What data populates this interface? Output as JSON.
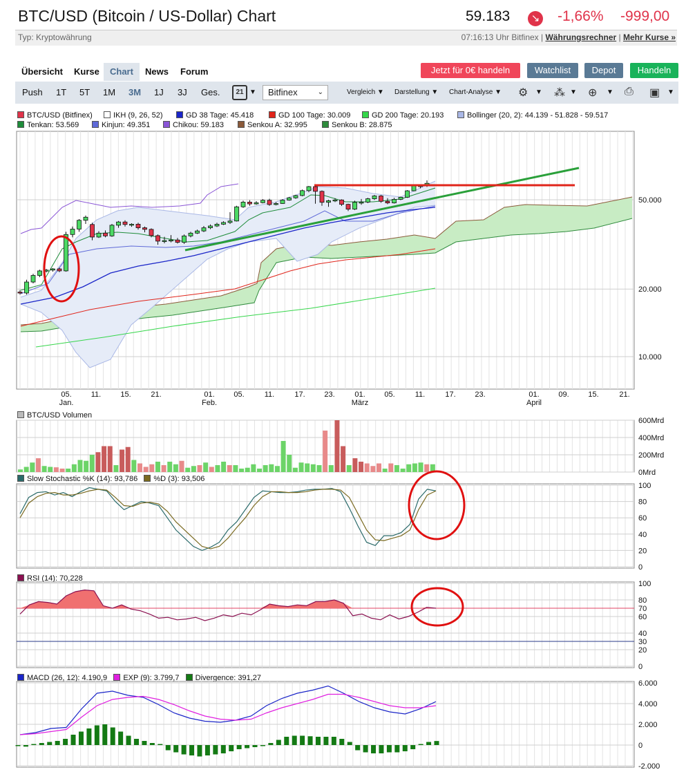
{
  "header": {
    "title": "BTC/USD (Bitcoin / US-Dollar) Chart",
    "price": "59.183",
    "arrow_icon": "arrow-down-right-icon",
    "change_pct": "-1,66%",
    "change_abs": "-999,00"
  },
  "subbar": {
    "type": "Typ: Kryptowährung",
    "time": "07:16:13 Uhr Bitfinex",
    "currency_link": "Währungsrechner",
    "more_link": "Mehr Kurse »"
  },
  "tabs": [
    "Übersicht",
    "Kurse",
    "Chart",
    "News",
    "Forum"
  ],
  "actions": {
    "trade_free": "Jetzt für 0€ handeln",
    "watchlist": "Watchlist",
    "depot": "Depot",
    "handeln": "Handeln"
  },
  "toolbar": {
    "ranges": [
      "Push",
      "1T",
      "5T",
      "1M",
      "3M",
      "1J",
      "3J",
      "Ges."
    ],
    "active_range": "3M",
    "calendar_day": "21",
    "exchange": "Bitfinex",
    "compare": "Vergleich",
    "display": "Darstellung",
    "analysis": "Chart-Analyse"
  },
  "colors": {
    "up": "#4cd964",
    "down": "#e0334a",
    "accent_red": "#f0465a",
    "btn_gray": "#5a7a95",
    "btn_green": "#19b35a"
  },
  "main_legend": [
    {
      "label": "BTC/USD (Bitfinex)",
      "color": "#e0334a"
    },
    {
      "label": "IKH (9, 26, 52)",
      "color": "#ffffff"
    },
    {
      "label": "GD 38 Tage: 45.418",
      "color": "#1a25c8"
    },
    {
      "label": "GD 100 Tage: 30.009",
      "color": "#e0241a"
    },
    {
      "label": "GD 200 Tage: 20.193",
      "color": "#35d64a"
    },
    {
      "label": "Bollinger (20, 2): 44.139 - 51.828 - 59.517",
      "color": "#aab8e6"
    },
    {
      "label": "Tenkan: 53.569",
      "color": "#1e8c3a"
    },
    {
      "label": "Kinjun: 49.351",
      "color": "#5f6ad8"
    },
    {
      "label": "Chikou: 59.183",
      "color": "#8a55d6"
    },
    {
      "label": "Senkou A: 32.995",
      "color": "#8b5a3a"
    },
    {
      "label": "Senkou B: 28.875",
      "color": "#2e8b3c"
    }
  ],
  "price_axis": [
    "50.000",
    "20.000",
    "10.000"
  ],
  "date_axis": [
    {
      "d": "05.",
      "m": "Jan."
    },
    {
      "d": "11.",
      "m": ""
    },
    {
      "d": "15.",
      "m": ""
    },
    {
      "d": "21.",
      "m": ""
    },
    {
      "d": "01.",
      "m": "Feb."
    },
    {
      "d": "05.",
      "m": ""
    },
    {
      "d": "11.",
      "m": ""
    },
    {
      "d": "17.",
      "m": ""
    },
    {
      "d": "23.",
      "m": ""
    },
    {
      "d": "01.",
      "m": "März"
    },
    {
      "d": "05.",
      "m": ""
    },
    {
      "d": "11.",
      "m": ""
    },
    {
      "d": "17.",
      "m": ""
    },
    {
      "d": "23.",
      "m": ""
    },
    {
      "d": "01.",
      "m": "April"
    },
    {
      "d": "09.",
      "m": ""
    },
    {
      "d": "15.",
      "m": ""
    },
    {
      "d": "21.",
      "m": ""
    }
  ],
  "volume": {
    "label": "BTC/USD Volumen",
    "axis": [
      "600Mrd",
      "400Mrd",
      "200Mrd",
      "0Mrd"
    ]
  },
  "stoch": {
    "k_label": "Slow Stochastic %K (14): 93,786",
    "d_label": "%D (3): 93,506",
    "axis": [
      "100",
      "80",
      "60",
      "40",
      "20",
      "0"
    ]
  },
  "rsi": {
    "label": "RSI (14): 70,228",
    "axis": [
      "100",
      "80",
      "70",
      "60",
      "40",
      "30",
      "20",
      "0"
    ]
  },
  "macd": {
    "macd_label": "MACD (26, 12): 4.190,9",
    "exp_label": "EXP (9): 3.799,7",
    "div_label": "Divergence: 391,27",
    "axis": [
      "6.000",
      "4.000",
      "2.000",
      "0",
      "-2.000"
    ]
  },
  "chart_data": [
    {
      "type": "candlestick",
      "ylabel": "",
      "scale": "log",
      "yticks": [
        10000,
        20000,
        50000
      ],
      "candles": [
        [
          19400,
          19200,
          19800,
          18900
        ],
        [
          19200,
          21500,
          22000,
          18900
        ],
        [
          21500,
          23000,
          23400,
          21200
        ],
        [
          23000,
          24100,
          24400,
          22600
        ],
        [
          24100,
          24300,
          24600,
          23700
        ],
        [
          24300,
          24600,
          24800,
          23900
        ],
        [
          24600,
          24100,
          24900,
          23800
        ],
        [
          24100,
          35000,
          36000,
          23900
        ],
        [
          35000,
          37000,
          38000,
          34000
        ],
        [
          37000,
          40500,
          41000,
          36000
        ],
        [
          40500,
          41800,
          42500,
          39000
        ],
        [
          38800,
          34100,
          39500,
          33000
        ],
        [
          34100,
          35500,
          36200,
          33800
        ],
        [
          35500,
          34500,
          36500,
          34000
        ],
        [
          34500,
          38500,
          39000,
          34200
        ],
        [
          38500,
          39800,
          40200,
          37500
        ],
        [
          39800,
          38800,
          40500,
          38000
        ],
        [
          38800,
          38900,
          39300,
          37900
        ],
        [
          38900,
          37500,
          39500,
          36800
        ],
        [
          37500,
          36900,
          38000,
          35800
        ],
        [
          36900,
          34600,
          37300,
          34000
        ],
        [
          34600,
          32700,
          35000,
          31500
        ],
        [
          32700,
          32900,
          34200,
          32000
        ],
        [
          32900,
          33100,
          34800,
          32300
        ],
        [
          33100,
          32300,
          33800,
          31900
        ],
        [
          32300,
          34500,
          35000,
          31800
        ],
        [
          34500,
          35500,
          36000,
          34000
        ],
        [
          35500,
          36300,
          36800,
          35200
        ],
        [
          36300,
          37500,
          38200,
          35900
        ],
        [
          37500,
          38200,
          38800,
          37000
        ],
        [
          38200,
          38900,
          39500,
          37800
        ],
        [
          38900,
          39600,
          40100,
          38600
        ],
        [
          39600,
          40200,
          44000,
          39000
        ],
        [
          40200,
          46500,
          47000,
          40000
        ],
        [
          46500,
          48800,
          49500,
          46000
        ],
        [
          48800,
          47900,
          49800,
          47000
        ],
        [
          47900,
          48500,
          49300,
          47500
        ],
        [
          48500,
          49700,
          50300,
          48200
        ],
        [
          49700,
          47600,
          50500,
          47000
        ],
        [
          47600,
          48100,
          48800,
          47200
        ],
        [
          48100,
          49800,
          50300,
          47900
        ],
        [
          49800,
          51000,
          51500,
          49500
        ],
        [
          51000,
          52200,
          52600,
          50500
        ],
        [
          52200,
          54900,
          55500,
          51800
        ],
        [
          54900,
          57200,
          57600,
          54000
        ],
        [
          57200,
          54500,
          58000,
          48000
        ],
        [
          54500,
          48700,
          55000,
          47000
        ],
        [
          48700,
          49500,
          50000,
          46500
        ],
        [
          49500,
          49900,
          50800,
          48800
        ],
        [
          49900,
          47700,
          50200,
          46900
        ],
        [
          47700,
          45400,
          48000,
          44500
        ],
        [
          45400,
          48700,
          49500,
          45000
        ],
        [
          48700,
          48800,
          50400,
          47500
        ],
        [
          48800,
          50500,
          51000,
          48300
        ],
        [
          50500,
          52000,
          52500,
          49900
        ],
        [
          52000,
          49200,
          52500,
          48500
        ],
        [
          49200,
          48400,
          50800,
          47800
        ],
        [
          48400,
          50200,
          51000,
          48100
        ],
        [
          50200,
          51300,
          51600,
          49800
        ],
        [
          51300,
          54800,
          55200,
          51000
        ],
        [
          54800,
          57600,
          58100,
          54500
        ],
        [
          57600,
          57800,
          58300,
          56200
        ],
        [
          57800,
          59183,
          61000,
          57000
        ]
      ]
    },
    {
      "type": "bar",
      "title": "BTC/USD Volumen",
      "unit": "Mrd",
      "ylim": [
        0,
        600
      ],
      "values": [
        30,
        60,
        110,
        160,
        70,
        60,
        55,
        40,
        40,
        90,
        140,
        130,
        200,
        230,
        300,
        300,
        80,
        260,
        290,
        140,
        100,
        60,
        90,
        120,
        80,
        120,
        90,
        130,
        50,
        70,
        80,
        110,
        60,
        80,
        120,
        80,
        80,
        40,
        50,
        90,
        40,
        80,
        90,
        70,
        360,
        200,
        50,
        110,
        100,
        90,
        80,
        480,
        80,
        600,
        300,
        80,
        160,
        120,
        100,
        70,
        100,
        40,
        100,
        80,
        40,
        90,
        100,
        110,
        90,
        90
      ],
      "colors": [
        "#6cd468",
        "#6cd468",
        "#6cd468",
        "#e88a8a",
        "#6cd468",
        "#6cd468",
        "#e88a8a",
        "#e88a8a",
        "#6cd468",
        "#6cd468",
        "#6cd468",
        "#6cd468",
        "#6cd468",
        "#c85c5c",
        "#c85c5c",
        "#c85c5c",
        "#6cd468",
        "#c85c5c",
        "#c85c5c",
        "#6cd468",
        "#e88a8a",
        "#e88a8a",
        "#e88a8a",
        "#6cd468",
        "#e88a8a",
        "#6cd468",
        "#6cd468",
        "#e88a8a",
        "#6cd468",
        "#6cd468",
        "#e88a8a",
        "#6cd468",
        "#e88a8a",
        "#6cd468",
        "#6cd468",
        "#e88a8a",
        "#6cd468",
        "#6cd468",
        "#6cd468",
        "#6cd468",
        "#6cd468",
        "#6cd468",
        "#6cd468",
        "#6cd468",
        "#6cd468",
        "#6cd468",
        "#6cd468",
        "#6cd468",
        "#6cd468",
        "#6cd468",
        "#6cd468",
        "#e88a8a",
        "#6cd468",
        "#c85c5c",
        "#c85c5c",
        "#6cd468",
        "#c85c5c",
        "#c85c5c",
        "#e88a8a",
        "#e88a8a",
        "#e88a8a",
        "#6cd468",
        "#e88a8a",
        "#6cd468",
        "#6cd468",
        "#6cd468",
        "#6cd468",
        "#6cd468",
        "#e88a8a",
        "#6cd468"
      ]
    },
    {
      "type": "line",
      "title": "Slow Stochastic",
      "ylim": [
        0,
        100
      ],
      "series": [
        {
          "name": "Slow Stochastic %K (14): 93,786",
          "color": "#2a6a6a",
          "values": [
            65,
            85,
            91,
            92,
            88,
            91,
            86,
            92,
            97,
            95,
            93,
            80,
            70,
            75,
            80,
            78,
            75,
            60,
            45,
            35,
            25,
            20,
            24,
            30,
            45,
            55,
            70,
            85,
            93,
            92,
            91,
            91,
            92,
            94,
            95,
            95,
            96,
            92,
            72,
            50,
            30,
            26,
            38,
            38,
            42,
            52,
            83,
            95,
            93
          ]
        },
        {
          "name": "%D (3): 93,506",
          "color": "#7a6a20",
          "values": [
            60,
            78,
            86,
            90,
            91,
            88,
            88,
            90,
            93,
            95,
            94,
            85,
            75,
            74,
            78,
            79,
            77,
            68,
            55,
            45,
            35,
            25,
            22,
            25,
            35,
            48,
            60,
            75,
            86,
            92,
            92,
            91,
            91,
            92,
            94,
            95,
            95,
            94,
            85,
            65,
            45,
            33,
            32,
            35,
            38,
            45,
            70,
            88,
            93
          ]
        }
      ]
    },
    {
      "type": "area",
      "title": "RSI",
      "ylim": [
        0,
        100
      ],
      "thresholds": [
        70,
        30
      ],
      "values": [
        63,
        74,
        78,
        77,
        75,
        85,
        90,
        92,
        91,
        73,
        70,
        74,
        69,
        67,
        63,
        58,
        59,
        56,
        57,
        59,
        55,
        58,
        62,
        60,
        64,
        62,
        68,
        75,
        73,
        72,
        74,
        73,
        78,
        78,
        80,
        76,
        61,
        63,
        58,
        56,
        62,
        57,
        60,
        65,
        71,
        70
      ]
    },
    {
      "type": "line",
      "title": "MACD",
      "ylim": [
        -2000,
        6000
      ],
      "series": [
        {
          "name": "MACD (26, 12): 4.190,9",
          "color": "#1a25c8",
          "values": [
            1000,
            1200,
            1600,
            1700,
            3500,
            5000,
            5200,
            4800,
            4600,
            3900,
            3100,
            2600,
            2300,
            2200,
            2400,
            2800,
            3800,
            4500,
            5000,
            5300,
            5700,
            5000,
            4200,
            3600,
            3200,
            3000,
            3500,
            4190.9
          ]
        },
        {
          "name": "EXP (9): 3.799,7",
          "color": "#e020e0",
          "values": [
            1000,
            1100,
            1300,
            1500,
            2700,
            3800,
            4400,
            4600,
            4700,
            4400,
            3900,
            3300,
            2800,
            2500,
            2400,
            2500,
            3100,
            3600,
            4000,
            4400,
            4900,
            4900,
            4600,
            4200,
            3800,
            3600,
            3600,
            3799.7
          ]
        },
        {
          "name": "Divergence: 391,27",
          "color": "#147a14",
          "values": [
            -100,
            -150,
            100,
            200,
            300,
            400,
            600,
            1000,
            1300,
            1600,
            1900,
            2000,
            1700,
            1300,
            900,
            600,
            400,
            200,
            100,
            -500,
            -700,
            -900,
            -1000,
            -1100,
            -1000,
            -900,
            -800,
            -600,
            -400,
            -300,
            -200,
            -100,
            200,
            500,
            800,
            900,
            900,
            850,
            800,
            800,
            800,
            600,
            300,
            -500,
            -700,
            -800,
            -800,
            -700,
            -700,
            -600,
            -400,
            100,
            300,
            391.27
          ]
        }
      ]
    }
  ]
}
